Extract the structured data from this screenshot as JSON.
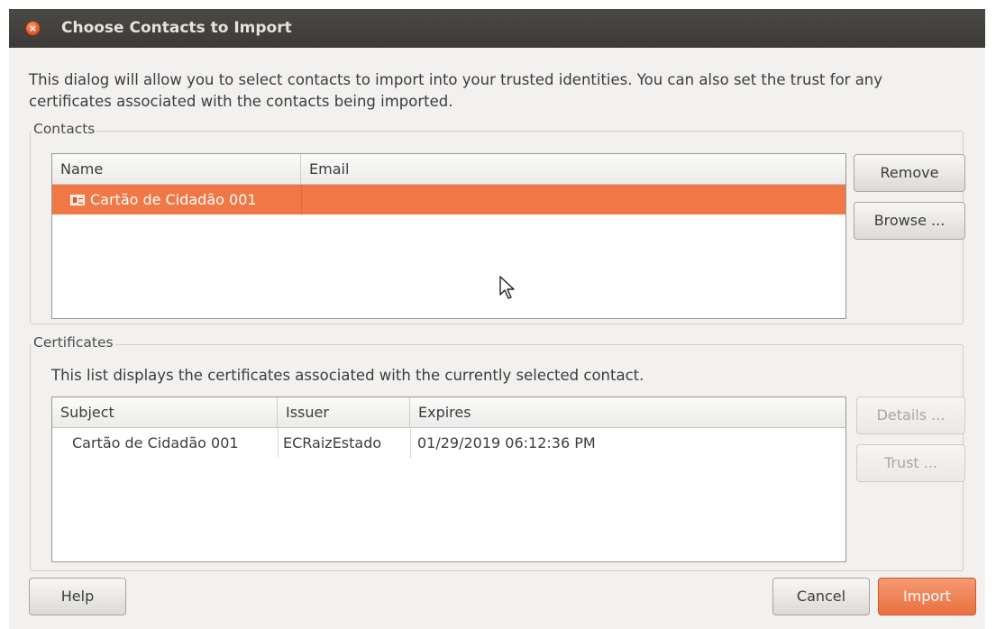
{
  "dialog": {
    "title": "Choose Contacts to Import",
    "close_symbol": "×",
    "description": "This dialog will allow you to select contacts to import into your trusted identities. You can also set the trust for any certificates associated with the contacts being imported."
  },
  "contacts": {
    "section_label": "Contacts",
    "columns": {
      "name": "Name",
      "email": "Email"
    },
    "rows": [
      {
        "name": "Cartão de Cidadão 001",
        "email": "",
        "selected": true,
        "icon": "contact-card-icon"
      }
    ],
    "buttons": {
      "remove": "Remove",
      "browse": "Browse ..."
    }
  },
  "certificates": {
    "section_label": "Certificates",
    "description": "This list displays the certificates associated with the currently selected contact.",
    "columns": {
      "subject": "Subject",
      "issuer": "Issuer",
      "expires": "Expires"
    },
    "rows": [
      {
        "subject": "Cartão de Cidadão 001",
        "issuer": "ECRaizEstado",
        "expires": "01/29/2019 06:12:36 PM"
      }
    ],
    "buttons": {
      "details": "Details ...",
      "trust": "Trust ..."
    }
  },
  "footer": {
    "help": "Help",
    "cancel": "Cancel",
    "import": "Import"
  },
  "colors": {
    "accent": "#f07746",
    "titlebar": "#3c3b37",
    "dialog_background": "#f2f1f0"
  }
}
